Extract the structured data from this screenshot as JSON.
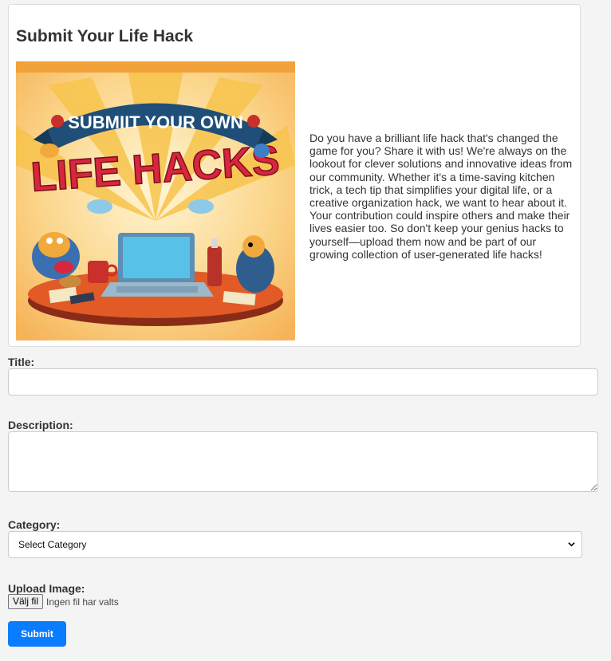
{
  "intro": {
    "title": "Submit Your Life Hack",
    "image_alt": "Submit your own life hacks illustration",
    "image_banner_text": "SUBMIIT YOUR OWN",
    "image_main_text": "LIFE HACKS",
    "description": "Do you have a brilliant life hack that's changed the game for you? Share it with us! We're always on the lookout for clever solutions and innovative ideas from our community. Whether it's a time-saving kitchen trick, a tech tip that simplifies your digital life, or a creative organization hack, we want to hear about it. Your contribution could inspire others and make their lives easier too. So don't keep your genius hacks to yourself—upload them now and be part of our growing collection of user-generated life hacks!"
  },
  "form": {
    "title_label": "Title:",
    "title_value": "",
    "description_label": "Description:",
    "description_value": "",
    "category_label": "Category:",
    "category_selected": "Select Category",
    "upload_label": "Upload Image:",
    "file_button": "Välj fil",
    "file_status": "Ingen fil har valts",
    "submit": "Submit"
  },
  "colors": {
    "accent": "#0a7cff",
    "page_background": "#f4f4f4",
    "card_background": "#ffffff"
  }
}
